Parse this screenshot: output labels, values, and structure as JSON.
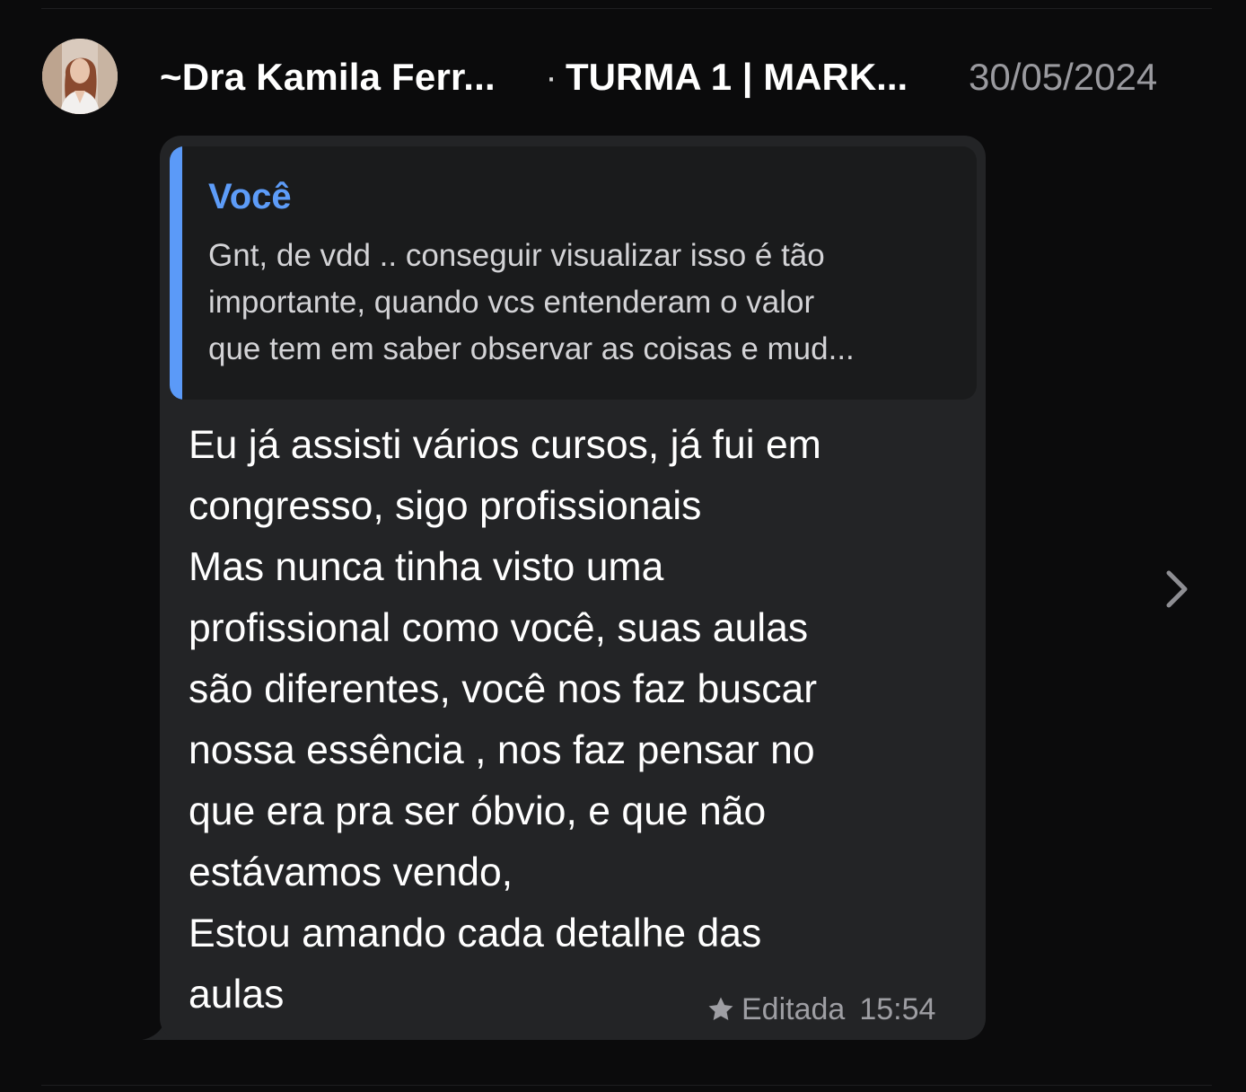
{
  "message": {
    "sender": "~Dra Kamila Ferr...",
    "separator": "·",
    "group": "TURMA 1 | MARK...",
    "date": "30/05/2024",
    "quoted": {
      "author": "Você",
      "lines": [
        "Gnt, de vdd .. conseguir visualizar isso é tão",
        "importante, quando vcs entenderam o valor",
        "que tem em saber observar as coisas e mud..."
      ]
    },
    "body_lines": [
      "Eu já assisti vários cursos, já fui em",
      "congresso, sigo profissionais",
      "Mas nunca tinha visto uma",
      "profissional como você, suas aulas",
      "são diferentes, você nos faz buscar",
      "nossa essência , nos faz pensar no",
      "que era pra ser óbvio, e que não",
      "estávamos vendo,",
      "Estou amando cada detalhe das",
      "aulas"
    ],
    "edited_label": "Editada",
    "time": "15:54",
    "icons": {
      "star": "star-icon",
      "chevron": "chevron-right-icon",
      "avatar": "avatar"
    }
  },
  "colors": {
    "background": "#0b0b0c",
    "bubble": "#232426",
    "quote_bg": "#1a1b1c",
    "quote_accent": "#5b9af8",
    "muted_text": "#9a9a9f"
  }
}
